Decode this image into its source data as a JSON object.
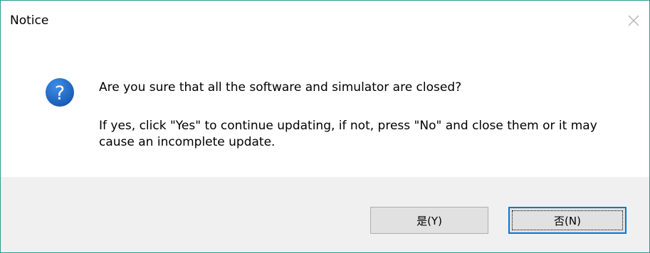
{
  "window": {
    "title": "Notice"
  },
  "message": {
    "main": "Are you sure that all the software and simulator are closed?",
    "detail": "If yes, click \"Yes\" to continue updating,  if not, press \"No\" and close them or it may cause an incomplete update."
  },
  "icons": {
    "dialog": "question-icon",
    "close": "close-icon"
  },
  "buttons": {
    "yes_label": "是(Y)",
    "no_label": "否(N)"
  },
  "colors": {
    "border": "#2b9c8f",
    "footer_bg": "#f0f0f0",
    "icon_blue": "#1d6fd0",
    "focus_border": "#0078d7"
  }
}
